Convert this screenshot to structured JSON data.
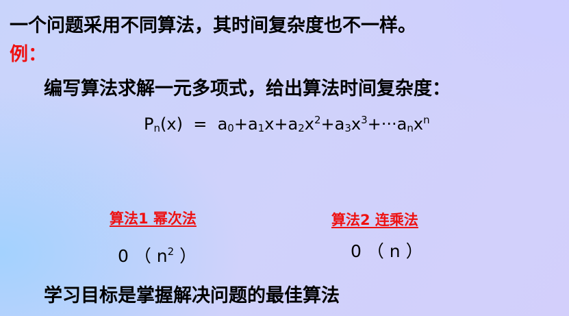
{
  "intro_line": "一个问题采用不同算法，其时间复杂度也不一样。",
  "example_label": "例：",
  "task_line": "编写算法求解一元多项式，给出算法时间复杂度：",
  "formula": {
    "lhs": "P",
    "lhs_sub": "n",
    "lhs_arg": "(x)",
    "eq": "=",
    "t0": "a",
    "t0_sub": "0",
    "plus1": "+",
    "t1": "a",
    "t1_sub": "1",
    "t1_var": "x",
    "plus2": "+",
    "t2": "a",
    "t2_sub": "2",
    "t2_var": "x",
    "t2_sup": "2",
    "plus3": "+",
    "t3": "a",
    "t3_sub": "3",
    "t3_var": "x",
    "t3_sup": "3",
    "plus4": "+",
    "ellipsis": "···",
    "tn": "a",
    "tn_sub": "n",
    "tn_var": "x",
    "tn_sup": "n"
  },
  "algorithms": [
    {
      "name": "算法1 幂次法",
      "complexity_open": "0 （ n",
      "complexity_sup": "2",
      "complexity_close": " ）"
    },
    {
      "name": "算法2 连乘法",
      "complexity": "0 （ n ）"
    }
  ],
  "goal_line": "学习目标是掌握解决问题的最佳算法",
  "colors": {
    "text": "#000000",
    "highlight": "#ee1111",
    "background": "#cfd2fb"
  }
}
